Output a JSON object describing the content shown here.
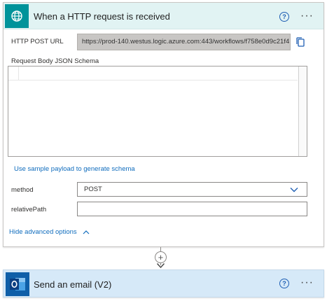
{
  "trigger": {
    "title": "When a HTTP request is received",
    "icon": "globe-icon",
    "url_label": "HTTP POST URL",
    "url_value": "https://prod-140.westus.logic.azure.com:443/workflows/f758e0d9c21f4...",
    "schema_label": "Request Body JSON Schema",
    "sample_link": "Use sample payload to generate schema",
    "method_label": "method",
    "method_value": "POST",
    "relative_path_label": "relativePath",
    "relative_path_value": "",
    "advanced_link": "Hide advanced options"
  },
  "action": {
    "title": "Send an email (V2)",
    "icon": "outlook-icon"
  },
  "connector": {
    "add_symbol": "+"
  },
  "colors": {
    "trigger_header_bg": "#e1f3f3",
    "trigger_icon_bg": "#00939a",
    "action_bg": "#d6e9f8",
    "action_icon_bg": "#0f5fa8",
    "link": "#0f6cbd"
  }
}
